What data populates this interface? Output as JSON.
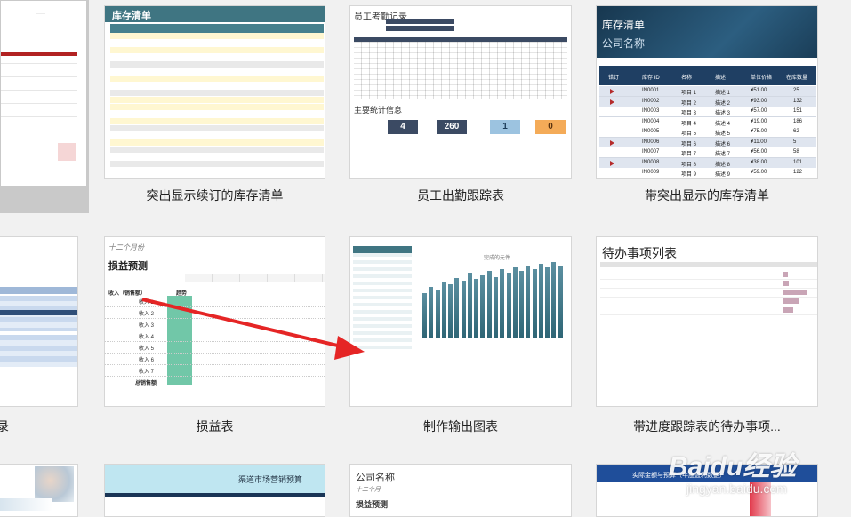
{
  "templates": [
    {
      "caption": "",
      "selected": true
    },
    {
      "caption": "突出显示续订的库存清单",
      "thumb_title": "库存清单"
    },
    {
      "caption": "员工出勤跟踪表",
      "thumb_title": "员工考勤记录",
      "section": "主要统计信息",
      "stats": [
        "4",
        "260",
        "1",
        "0"
      ]
    },
    {
      "caption": "带突出显示的库存清单",
      "thumb_title": "库存清单",
      "company": "公司名称",
      "headers": [
        "错订",
        "库存 ID",
        "名称",
        "描述",
        "单位价格",
        "在库数量"
      ],
      "rows": [
        [
          "IN0001",
          "项目 1",
          "描述 1",
          "¥51.00",
          "25"
        ],
        [
          "IN0002",
          "项目 2",
          "描述 2",
          "¥93.00",
          "132"
        ],
        [
          "IN0003",
          "项目 3",
          "描述 3",
          "¥57.00",
          "151"
        ],
        [
          "IN0004",
          "项目 4",
          "描述 4",
          "¥19.00",
          "186"
        ],
        [
          "IN0005",
          "项目 5",
          "描述 5",
          "¥75.00",
          "62"
        ],
        [
          "IN0006",
          "项目 6",
          "描述 6",
          "¥11.00",
          "5"
        ],
        [
          "IN0007",
          "项目 7",
          "描述 7",
          "¥56.00",
          "58"
        ],
        [
          "IN0008",
          "项目 8",
          "描述 8",
          "¥38.00",
          "101"
        ],
        [
          "IN0009",
          "项目 9",
          "描述 9",
          "¥59.00",
          "122"
        ]
      ],
      "flag_rows": [
        0,
        1,
        5,
        7
      ]
    },
    {
      "caption": "录"
    },
    {
      "caption": "损益表",
      "month_label": "十二个月份",
      "thumb_title": "损益预测",
      "income_header": "收入（销售额）",
      "trend": "趋势",
      "income_rows": [
        "收入 1",
        "收入 2",
        "收入 3",
        "收入 4",
        "收入 5",
        "收入 6",
        "收入 7"
      ],
      "total": "总销售额"
    },
    {
      "caption": "制作输出图表",
      "chart_title": "完成的元件"
    },
    {
      "caption": "带进度跟踪表的待办事项...",
      "thumb_title": "待办事项列表"
    },
    {
      "company": "公司名称",
      "month_label": "十二个月",
      "thumb_title": "损益预测"
    },
    {
      "thumb_title": "渠道市场营销预算"
    },
    {
      "thumb_title": "实际金额与预算（年度盈利数据）"
    }
  ],
  "chart_bars": [
    48,
    55,
    52,
    60,
    58,
    65,
    62,
    70,
    64,
    68,
    72,
    66,
    74,
    70,
    76,
    72,
    78,
    74,
    80,
    76,
    82,
    78
  ],
  "todo_progress": [
    0.15,
    0.2,
    0.9,
    0.55,
    0.35
  ],
  "watermark": {
    "brand": "Baidu经验",
    "url": "jingyan.baidu.com"
  }
}
